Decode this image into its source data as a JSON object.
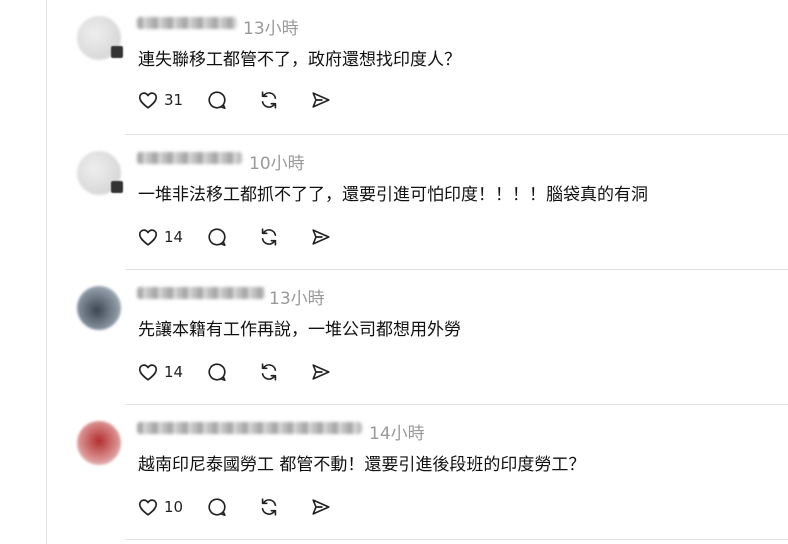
{
  "comments": [
    {
      "time": "13小時",
      "text": "連失聯移工都管不了，政府還想找印度人？",
      "likes": "31",
      "avatar_color": "#d8d8d8"
    },
    {
      "time": "10小時",
      "text": "一堆非法移工都抓不了了，還要引進可怕印度！！！！腦袋真的有洞",
      "likes": "14",
      "avatar_color": "#d6d6d6"
    },
    {
      "time": "13小時",
      "text": "先讓本籍有工作再說，一堆公司都想用外勞",
      "likes": "14",
      "avatar_color": "#6e7c88"
    },
    {
      "time": "14小時",
      "text": "越南印尼泰國勞工 都管不動！還要引進後段班的印度勞工？",
      "likes": "10",
      "avatar_color": "#a33a3a"
    }
  ],
  "icons": {
    "like": "heart-icon",
    "reply": "comment-bubble-icon",
    "repost": "repost-icon",
    "share": "send-icon"
  }
}
